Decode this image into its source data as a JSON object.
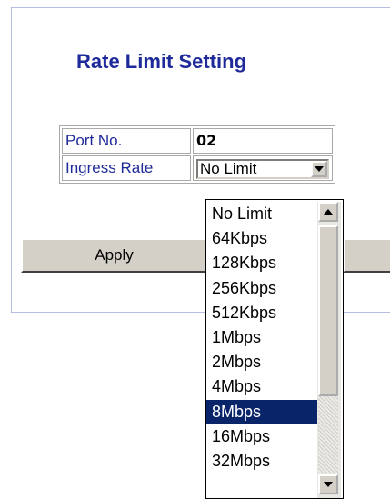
{
  "title": "Rate Limit Setting",
  "form": {
    "port_label": "Port No.",
    "port_value": "02",
    "ingress_label": "Ingress Rate",
    "ingress_selected": "No Limit"
  },
  "buttons": {
    "apply_label": "Apply"
  },
  "dropdown": {
    "options": [
      "No Limit",
      "64Kbps",
      "128Kbps",
      "256Kbps",
      "512Kbps",
      "1Mbps",
      "2Mbps",
      "4Mbps",
      "8Mbps",
      "16Mbps",
      "32Mbps"
    ],
    "highlighted": "8Mbps"
  },
  "colors": {
    "title": "#1f2a9a",
    "highlight": "#0a246a",
    "button_face": "#d4d0c8"
  },
  "icons": {
    "select_arrow": "chevron-down-icon",
    "scroll_up": "scroll-up-arrow-icon",
    "scroll_down": "scroll-down-arrow-icon"
  }
}
